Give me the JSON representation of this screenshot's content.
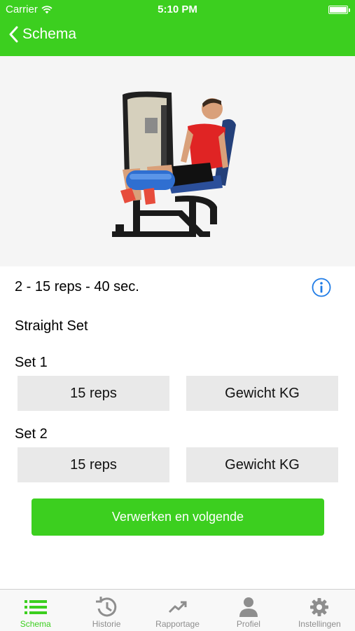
{
  "status_bar": {
    "carrier": "Carrier",
    "time": "5:10 PM"
  },
  "nav": {
    "back_label": "Schema"
  },
  "exercise": {
    "summary": "2 - 15 reps - 40 sec.",
    "set_type": "Straight Set",
    "sets": [
      {
        "label": "Set 1",
        "reps": "15 reps",
        "weight": "Gewicht  KG"
      },
      {
        "label": "Set 2",
        "reps": "15 reps",
        "weight": "Gewicht  KG"
      }
    ]
  },
  "primary_button": "Verwerken en volgende",
  "tabs": [
    {
      "label": "Schema",
      "icon": "list-icon",
      "active": true
    },
    {
      "label": "Historie",
      "icon": "history-icon",
      "active": false
    },
    {
      "label": "Rapportage",
      "icon": "trend-icon",
      "active": false
    },
    {
      "label": "Profiel",
      "icon": "person-icon",
      "active": false
    },
    {
      "label": "Instellingen",
      "icon": "gear-icon",
      "active": false
    }
  ],
  "colors": {
    "accent": "#3ccf1f",
    "field_bg": "#e9e9e9",
    "info_blue": "#1e7be6",
    "tab_inactive": "#8e8e8e"
  }
}
